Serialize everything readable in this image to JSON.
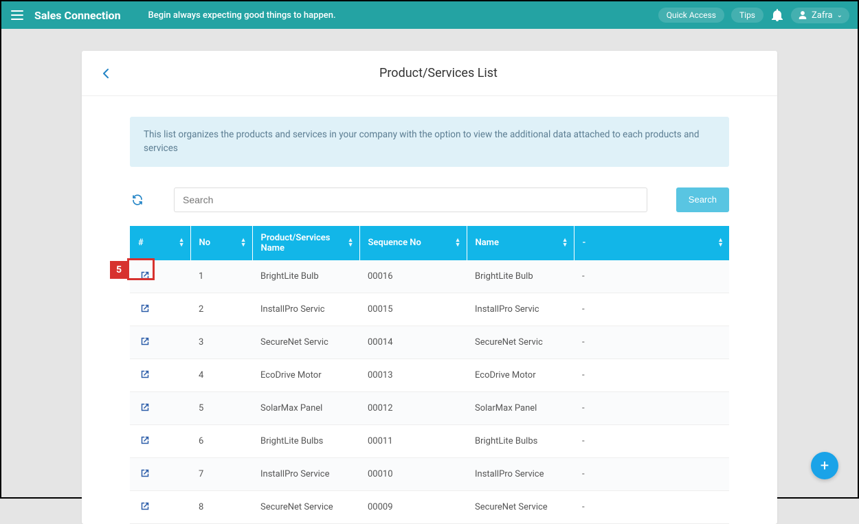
{
  "topbar": {
    "brand": "Sales Connection",
    "tagline": "Begin always expecting good things to happen.",
    "quick_access": "Quick Access",
    "tips": "Tips",
    "user_name": "Zafra"
  },
  "page": {
    "title": "Product/Services List",
    "info_text": "This list organizes the products and services in your company with the option to view the additional data attached to each products and services",
    "search_placeholder": "Search",
    "search_button": "Search"
  },
  "callout": {
    "number": "5"
  },
  "table": {
    "headers": {
      "hash": "#",
      "no": "No",
      "psn": "Product/Services Name",
      "seq": "Sequence No",
      "name": "Name",
      "dash": "-"
    },
    "rows": [
      {
        "no": "1",
        "psn": "BrightLite Bulb",
        "seq": "00016",
        "name": "BrightLite Bulb",
        "dash": "-"
      },
      {
        "no": "2",
        "psn": "InstallPro Servic",
        "seq": "00015",
        "name": "InstallPro Servic",
        "dash": "-"
      },
      {
        "no": "3",
        "psn": "SecureNet Servic",
        "seq": "00014",
        "name": "SecureNet Servic",
        "dash": "-"
      },
      {
        "no": "4",
        "psn": "EcoDrive Motor",
        "seq": "00013",
        "name": "EcoDrive Motor",
        "dash": "-"
      },
      {
        "no": "5",
        "psn": "SolarMax Panel",
        "seq": "00012",
        "name": "SolarMax Panel",
        "dash": "-"
      },
      {
        "no": "6",
        "psn": "BrightLite Bulbs",
        "seq": "00011",
        "name": "BrightLite Bulbs",
        "dash": "-"
      },
      {
        "no": "7",
        "psn": "InstallPro Service",
        "seq": "00010",
        "name": "InstallPro Service",
        "dash": "-"
      },
      {
        "no": "8",
        "psn": "SecureNet Service",
        "seq": "00009",
        "name": "SecureNet Service",
        "dash": "-"
      }
    ]
  }
}
